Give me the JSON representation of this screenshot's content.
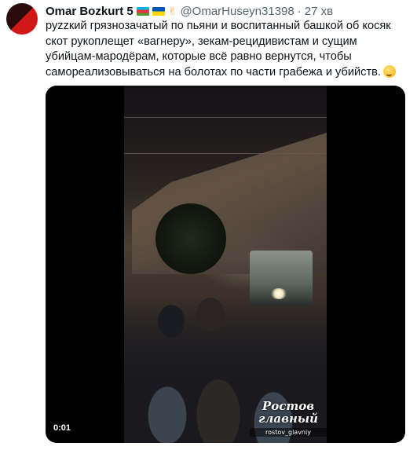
{
  "author": {
    "name": "Omar Bozkurt 5",
    "handle": "@OmarHuseyn31398",
    "separator": "·",
    "time": "27 хв"
  },
  "tweet": {
    "text": "руzzкий грязнозачатый по пьяни и воспитанный башкой об косяк скот рукоплещет «вагнеру», зекам-рецидивистам и сущим убийцам-мародёрам, которые всё равно вернутся, чтобы самореализовываться на болотах по части грабежа и убийств."
  },
  "media": {
    "watermark_line1": "Ростов",
    "watermark_line2": "главный",
    "watermark_handle": "rostov_glavniy",
    "timecode": "0:01"
  },
  "colors": {
    "text": "#0f1419",
    "secondary": "#536471"
  },
  "icons": [
    "azerbaijan-flag-icon",
    "ukraine-flag-icon",
    "victory-hand-icon",
    "thinking-face-icon"
  ]
}
